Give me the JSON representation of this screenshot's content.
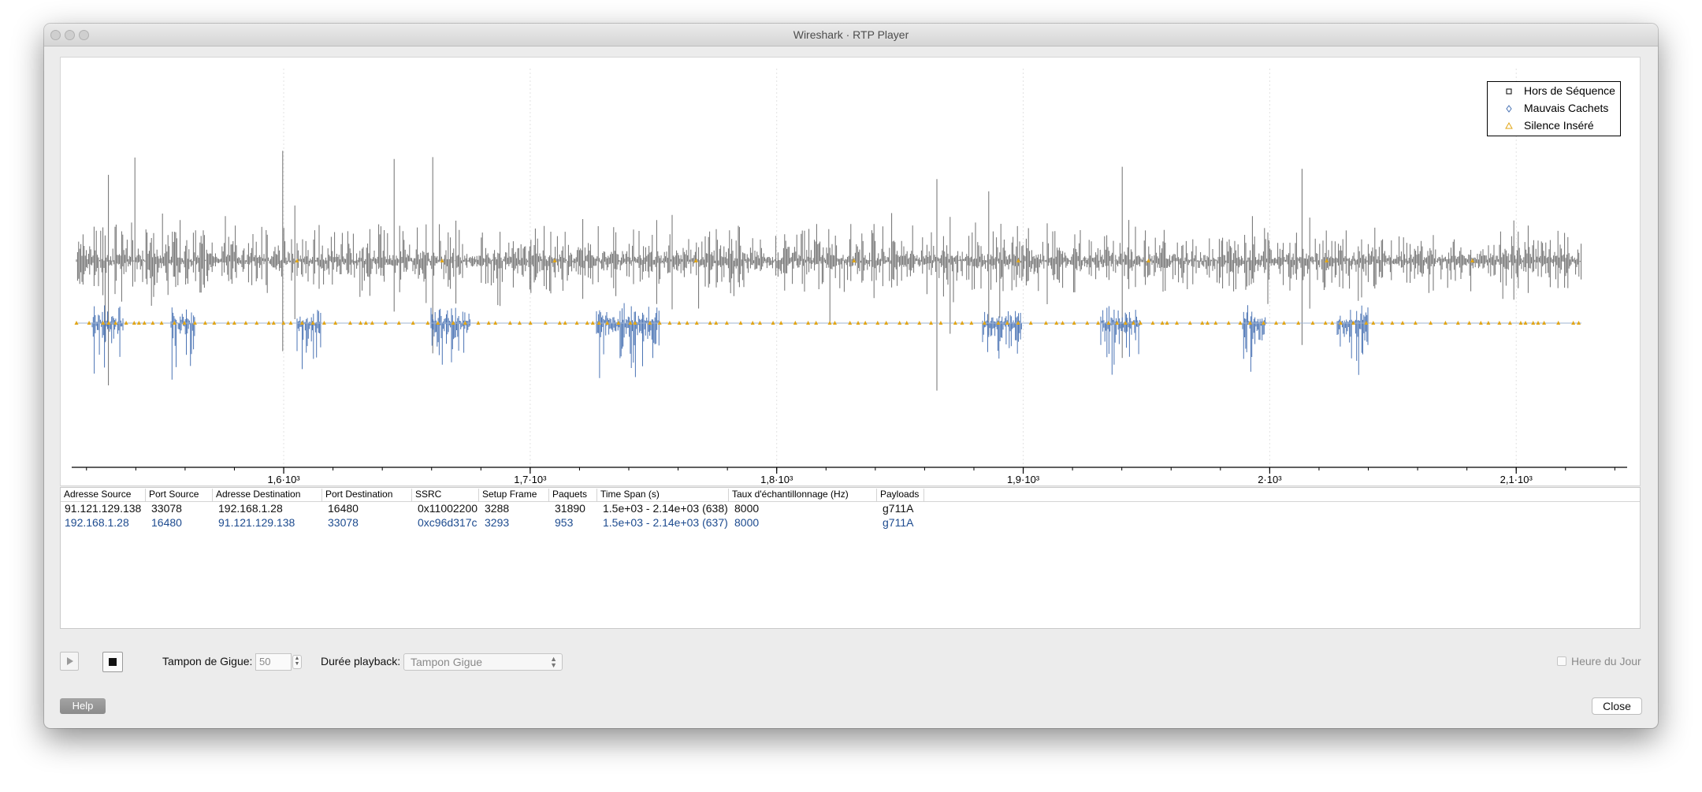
{
  "window": {
    "title": "Wireshark · RTP Player"
  },
  "chart_data": {
    "type": "line",
    "x_ticks": [
      "1,6·10³",
      "1,7·10³",
      "1,8·10³",
      "1,9·10³",
      "2·10³",
      "2,1·10³"
    ],
    "x_tick_values": [
      1600,
      1700,
      1800,
      1900,
      2000,
      2100
    ],
    "xlim": [
      1514,
      2145
    ],
    "grid": true,
    "legend_placement": "top-right",
    "legend": [
      {
        "label": "Hors de Séquence",
        "marker": "square",
        "color": "#000000"
      },
      {
        "label": "Mauvais Cachets",
        "marker": "diamond",
        "color": "#4a73b4"
      },
      {
        "label": "Silence Inséré",
        "marker": "triangle",
        "color": "#e2a616"
      }
    ],
    "series": [
      {
        "color": "#6f6f6f"
      },
      {
        "color": "#4a73b4"
      }
    ]
  },
  "table": {
    "headers": [
      "Adresse Source",
      "Port Source",
      "Adresse Destination",
      "Port Destination",
      "SSRC",
      "Setup Frame",
      "Paquets",
      "Time Span (s)",
      "Taux d'échantillonnage (Hz)",
      "Payloads"
    ],
    "rows": [
      [
        "91.121.129.138",
        "33078",
        "192.168.1.28",
        "16480",
        "0x11002200",
        "3288",
        "31890",
        "1.5e+03 - 2.14e+03 (638)",
        "8000",
        "g711A"
      ],
      [
        "192.168.1.28",
        "16480",
        "91.121.129.138",
        "33078",
        "0xc96d317c",
        "3293",
        "953",
        "1.5e+03 - 2.14e+03 (637)",
        "8000",
        "g711A"
      ]
    ]
  },
  "controls": {
    "jitter_label": "Tampon de Gigue:",
    "jitter_value": "50",
    "playback_label": "Durée playback:",
    "playback_value": "Tampon Gigue",
    "time_of_day_label": "Heure du Jour",
    "help_label": "Help",
    "close_label": "Close"
  },
  "colors": {
    "stream1": "#6f6f6f",
    "stream2": "#4a73b4",
    "silence_marker": "#e2a616"
  }
}
